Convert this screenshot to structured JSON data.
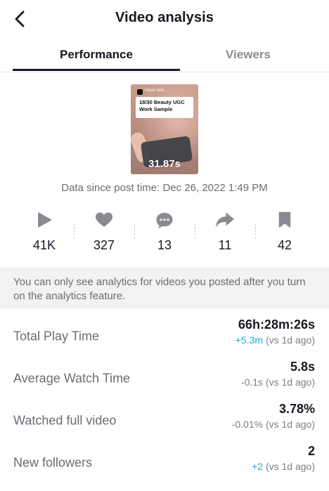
{
  "header": {
    "title": "Video analysis",
    "back_icon": "chevron-left-icon"
  },
  "tabs": [
    {
      "label": "Performance",
      "active": true
    },
    {
      "label": "Viewers",
      "active": false
    }
  ],
  "video": {
    "duration": "31.87s",
    "overlay_title": "18/30 Beauty UGC Work Sample",
    "top_text": "Made with ..."
  },
  "since_text": "Data since post time: Dec 26, 2022 1:49 PM",
  "stats": [
    {
      "icon": "play-icon",
      "value": "41K"
    },
    {
      "icon": "heart-icon",
      "value": "327"
    },
    {
      "icon": "comment-icon",
      "value": "13"
    },
    {
      "icon": "share-icon",
      "value": "11"
    },
    {
      "icon": "bookmark-icon",
      "value": "42"
    }
  ],
  "notice": "You can only see analytics for videos you posted after you turn on the analytics feature.",
  "metrics": [
    {
      "label": "Total Play Time",
      "value": "66h:28m:26s",
      "delta": "+5.3m",
      "delta_positive": true,
      "compare": "(vs 1d ago)"
    },
    {
      "label": "Average Watch Time",
      "value": "5.8s",
      "delta": "-0.1s",
      "delta_positive": false,
      "compare": "(vs 1d ago)"
    },
    {
      "label": "Watched full video",
      "value": "3.78%",
      "delta": "-0.01%",
      "delta_positive": false,
      "compare": "(vs 1d ago)"
    },
    {
      "label": "New followers",
      "value": "2",
      "delta": "+2",
      "delta_positive": true,
      "compare": "(vs 1d ago)"
    }
  ],
  "colors": {
    "text": "#161823",
    "muted": "#6b6c72",
    "positive": "#25a9d6",
    "icon": "#8a8b91",
    "notice_bg": "#f2f2f2"
  }
}
